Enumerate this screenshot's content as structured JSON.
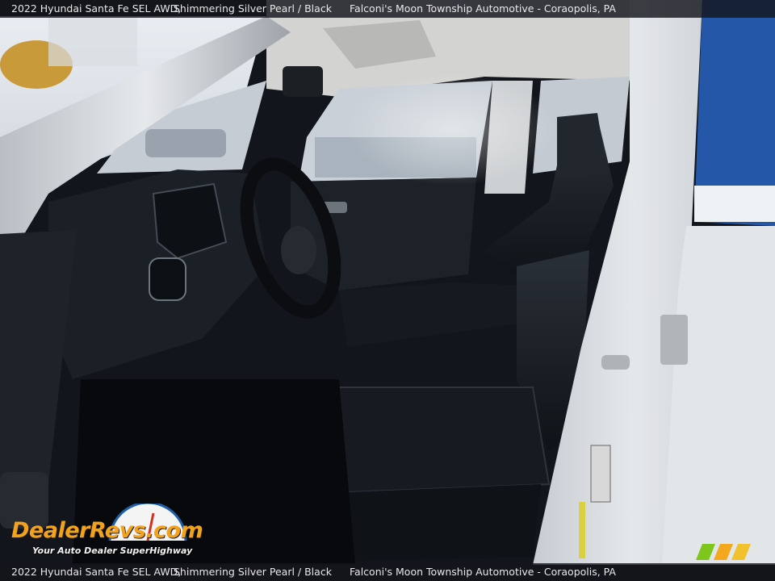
{
  "caption": {
    "vehicle": "2022 Hyundai Santa Fe SEL AWD,",
    "color": "Shimmering Silver Pearl / Black",
    "dealer": "Falconi's Moon Township Automotive - Coraopolis, PA"
  },
  "watermark": {
    "brand": "DealerRevs.com",
    "tagline": "Your Auto Dealer SuperHighway"
  },
  "colors": {
    "logo_orange": "#f2a21b",
    "logo_blue": "#1f5fa8",
    "stripe_colors": [
      "#7ec51c",
      "#f3a81e",
      "#f2c12e"
    ]
  }
}
